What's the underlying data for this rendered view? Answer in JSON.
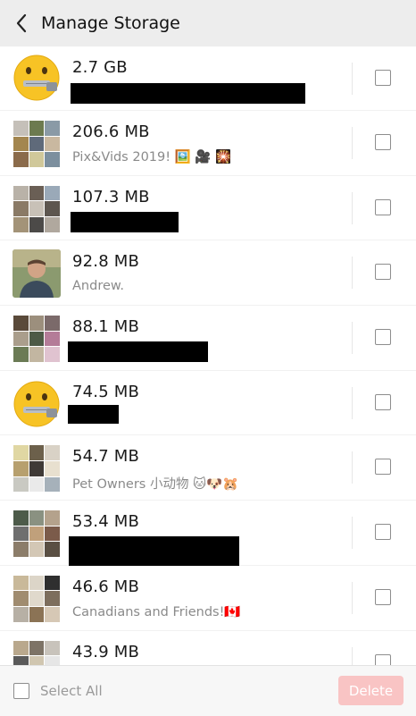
{
  "header": {
    "title": "Manage Storage"
  },
  "items": [
    {
      "size": "2.7 GB",
      "name": "",
      "avatar": "zipper-mouth-emoji",
      "redacted": true
    },
    {
      "size": "206.6 MB",
      "name": "Pix&Vids 2019! 🖼️ 🎥 🎇",
      "avatar": "photo-collage",
      "redacted": false
    },
    {
      "size": "107.3 MB",
      "name": "",
      "avatar": "photo-collage",
      "redacted": true
    },
    {
      "size": "92.8 MB",
      "name": "Andrew.",
      "avatar": "profile-photo",
      "redacted": false
    },
    {
      "size": "88.1 MB",
      "name": "",
      "avatar": "photo-collage",
      "redacted": true
    },
    {
      "size": "74.5 MB",
      "name": "",
      "avatar": "zipper-mouth-emoji",
      "redacted": true
    },
    {
      "size": "54.7 MB",
      "name": "Pet Owners 小动物 🐱🐶🐹",
      "avatar": "photo-collage",
      "redacted": false
    },
    {
      "size": "53.4 MB",
      "name": "",
      "avatar": "photo-collage",
      "redacted": true
    },
    {
      "size": "46.6 MB",
      "name": "Canadians and Friends!🇨🇦",
      "avatar": "photo-collage",
      "redacted": false
    },
    {
      "size": "43.9 MB",
      "name": "",
      "avatar": "photo-collage",
      "redacted": false
    }
  ],
  "footer": {
    "select_all_label": "Select All",
    "delete_label": "Delete"
  },
  "colors": {
    "header_bg": "#ededed",
    "delete_disabled": "#f9c4c4"
  }
}
